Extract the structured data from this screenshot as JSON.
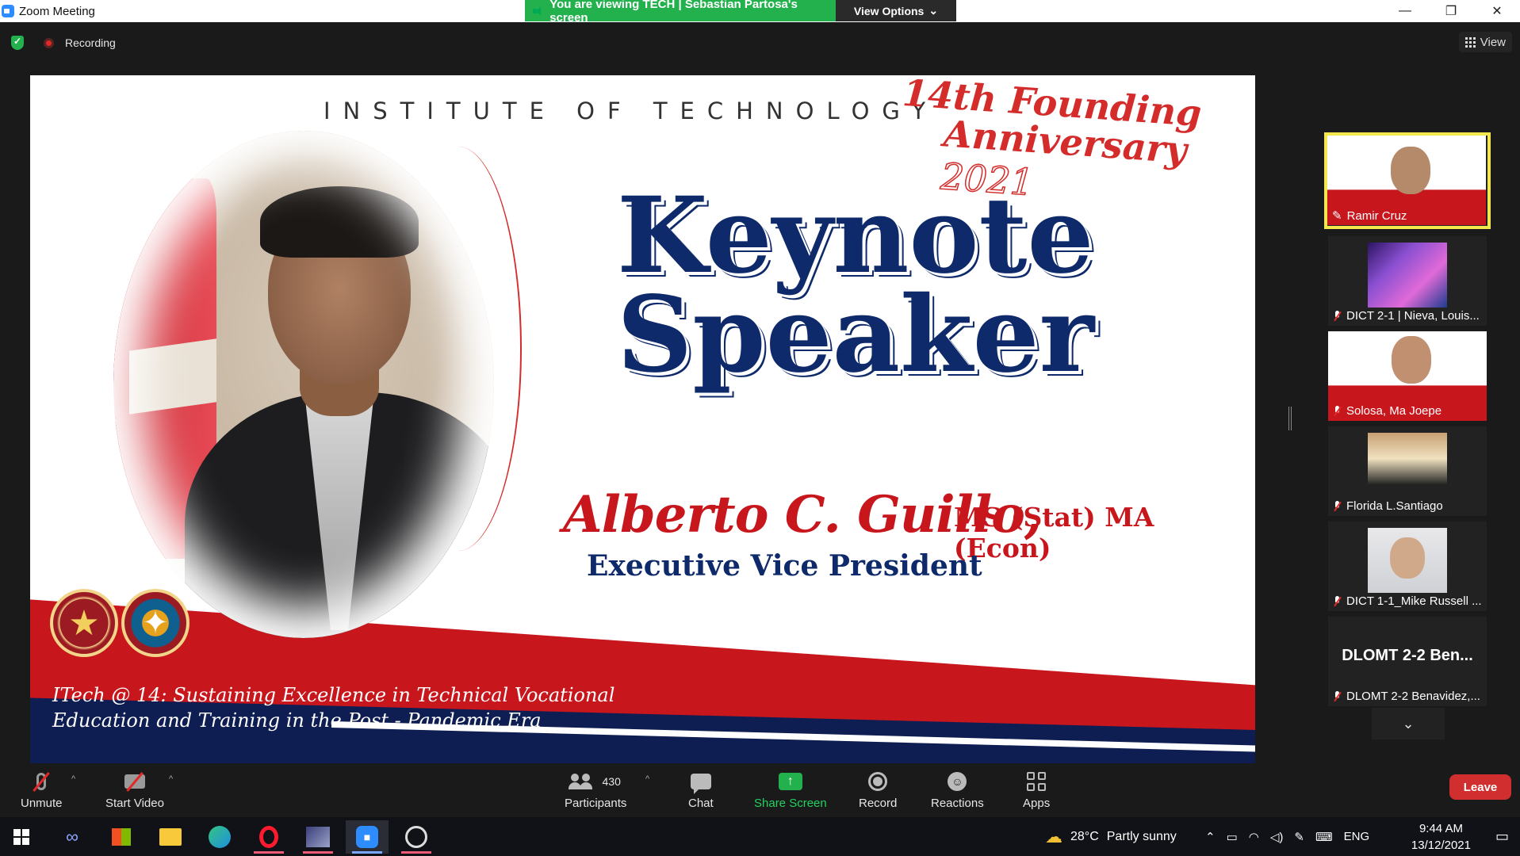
{
  "window": {
    "title": "Zoom Meeting",
    "share_banner": "You are viewing TECH | Sebastian Partosa's screen",
    "view_options": "View Options",
    "min": "—",
    "restore": "❐",
    "close": "✕"
  },
  "meeting_bar": {
    "recording_label": "Recording",
    "view_label": "View"
  },
  "slide": {
    "institute": "INSTITUTE OF TECHNOLOGY",
    "founding_line1": "14th Founding",
    "founding_line2": "Anniversary",
    "founding_year": "2021",
    "heading_line1": "Keynote",
    "heading_line2": "Speaker",
    "speaker_name": "Alberto C. Guillo,",
    "degree": "MS (Stat) MA (Econ)",
    "position": "Executive Vice President",
    "tagline_line1": "ITech @ 14: Sustaining Excellence in Technical Vocational",
    "tagline_line2": "Education and Training in the Post - Pandemic Era"
  },
  "participants_panel": {
    "tiles": [
      {
        "name": "Ramir Cruz",
        "active": true,
        "muted": false
      },
      {
        "name": "DICT 2-1 | Nieva, Louis...",
        "muted": true
      },
      {
        "name": "Solosa, Ma Joepe",
        "muted": true
      },
      {
        "name": "Florida L.Santiago",
        "muted": true
      },
      {
        "name": "DICT 1-1_Mike Russell ...",
        "muted": true
      },
      {
        "name": "DLOMT 2-2 Benavidez,...",
        "display_text": "DLOMT 2-2 Ben...",
        "muted": true
      }
    ],
    "scroll_down": "⌄"
  },
  "toolbar": {
    "unmute": "Unmute",
    "start_video": "Start Video",
    "participants": "Participants",
    "participants_count": "430",
    "chat": "Chat",
    "share_screen": "Share Screen",
    "record": "Record",
    "reactions": "Reactions",
    "apps": "Apps",
    "leave": "Leave"
  },
  "taskbar": {
    "weather_temp": "28°C",
    "weather_text": "Partly sunny",
    "language": "ENG",
    "time": "9:44 AM",
    "date": "13/12/2021"
  },
  "colors": {
    "zoom_blue": "#2d8cff",
    "share_green": "#23b14d",
    "leave_red": "#d12f2f",
    "slide_navy": "#0e2a6b",
    "slide_red": "#c8161d",
    "active_speaker": "#f4e64d"
  }
}
